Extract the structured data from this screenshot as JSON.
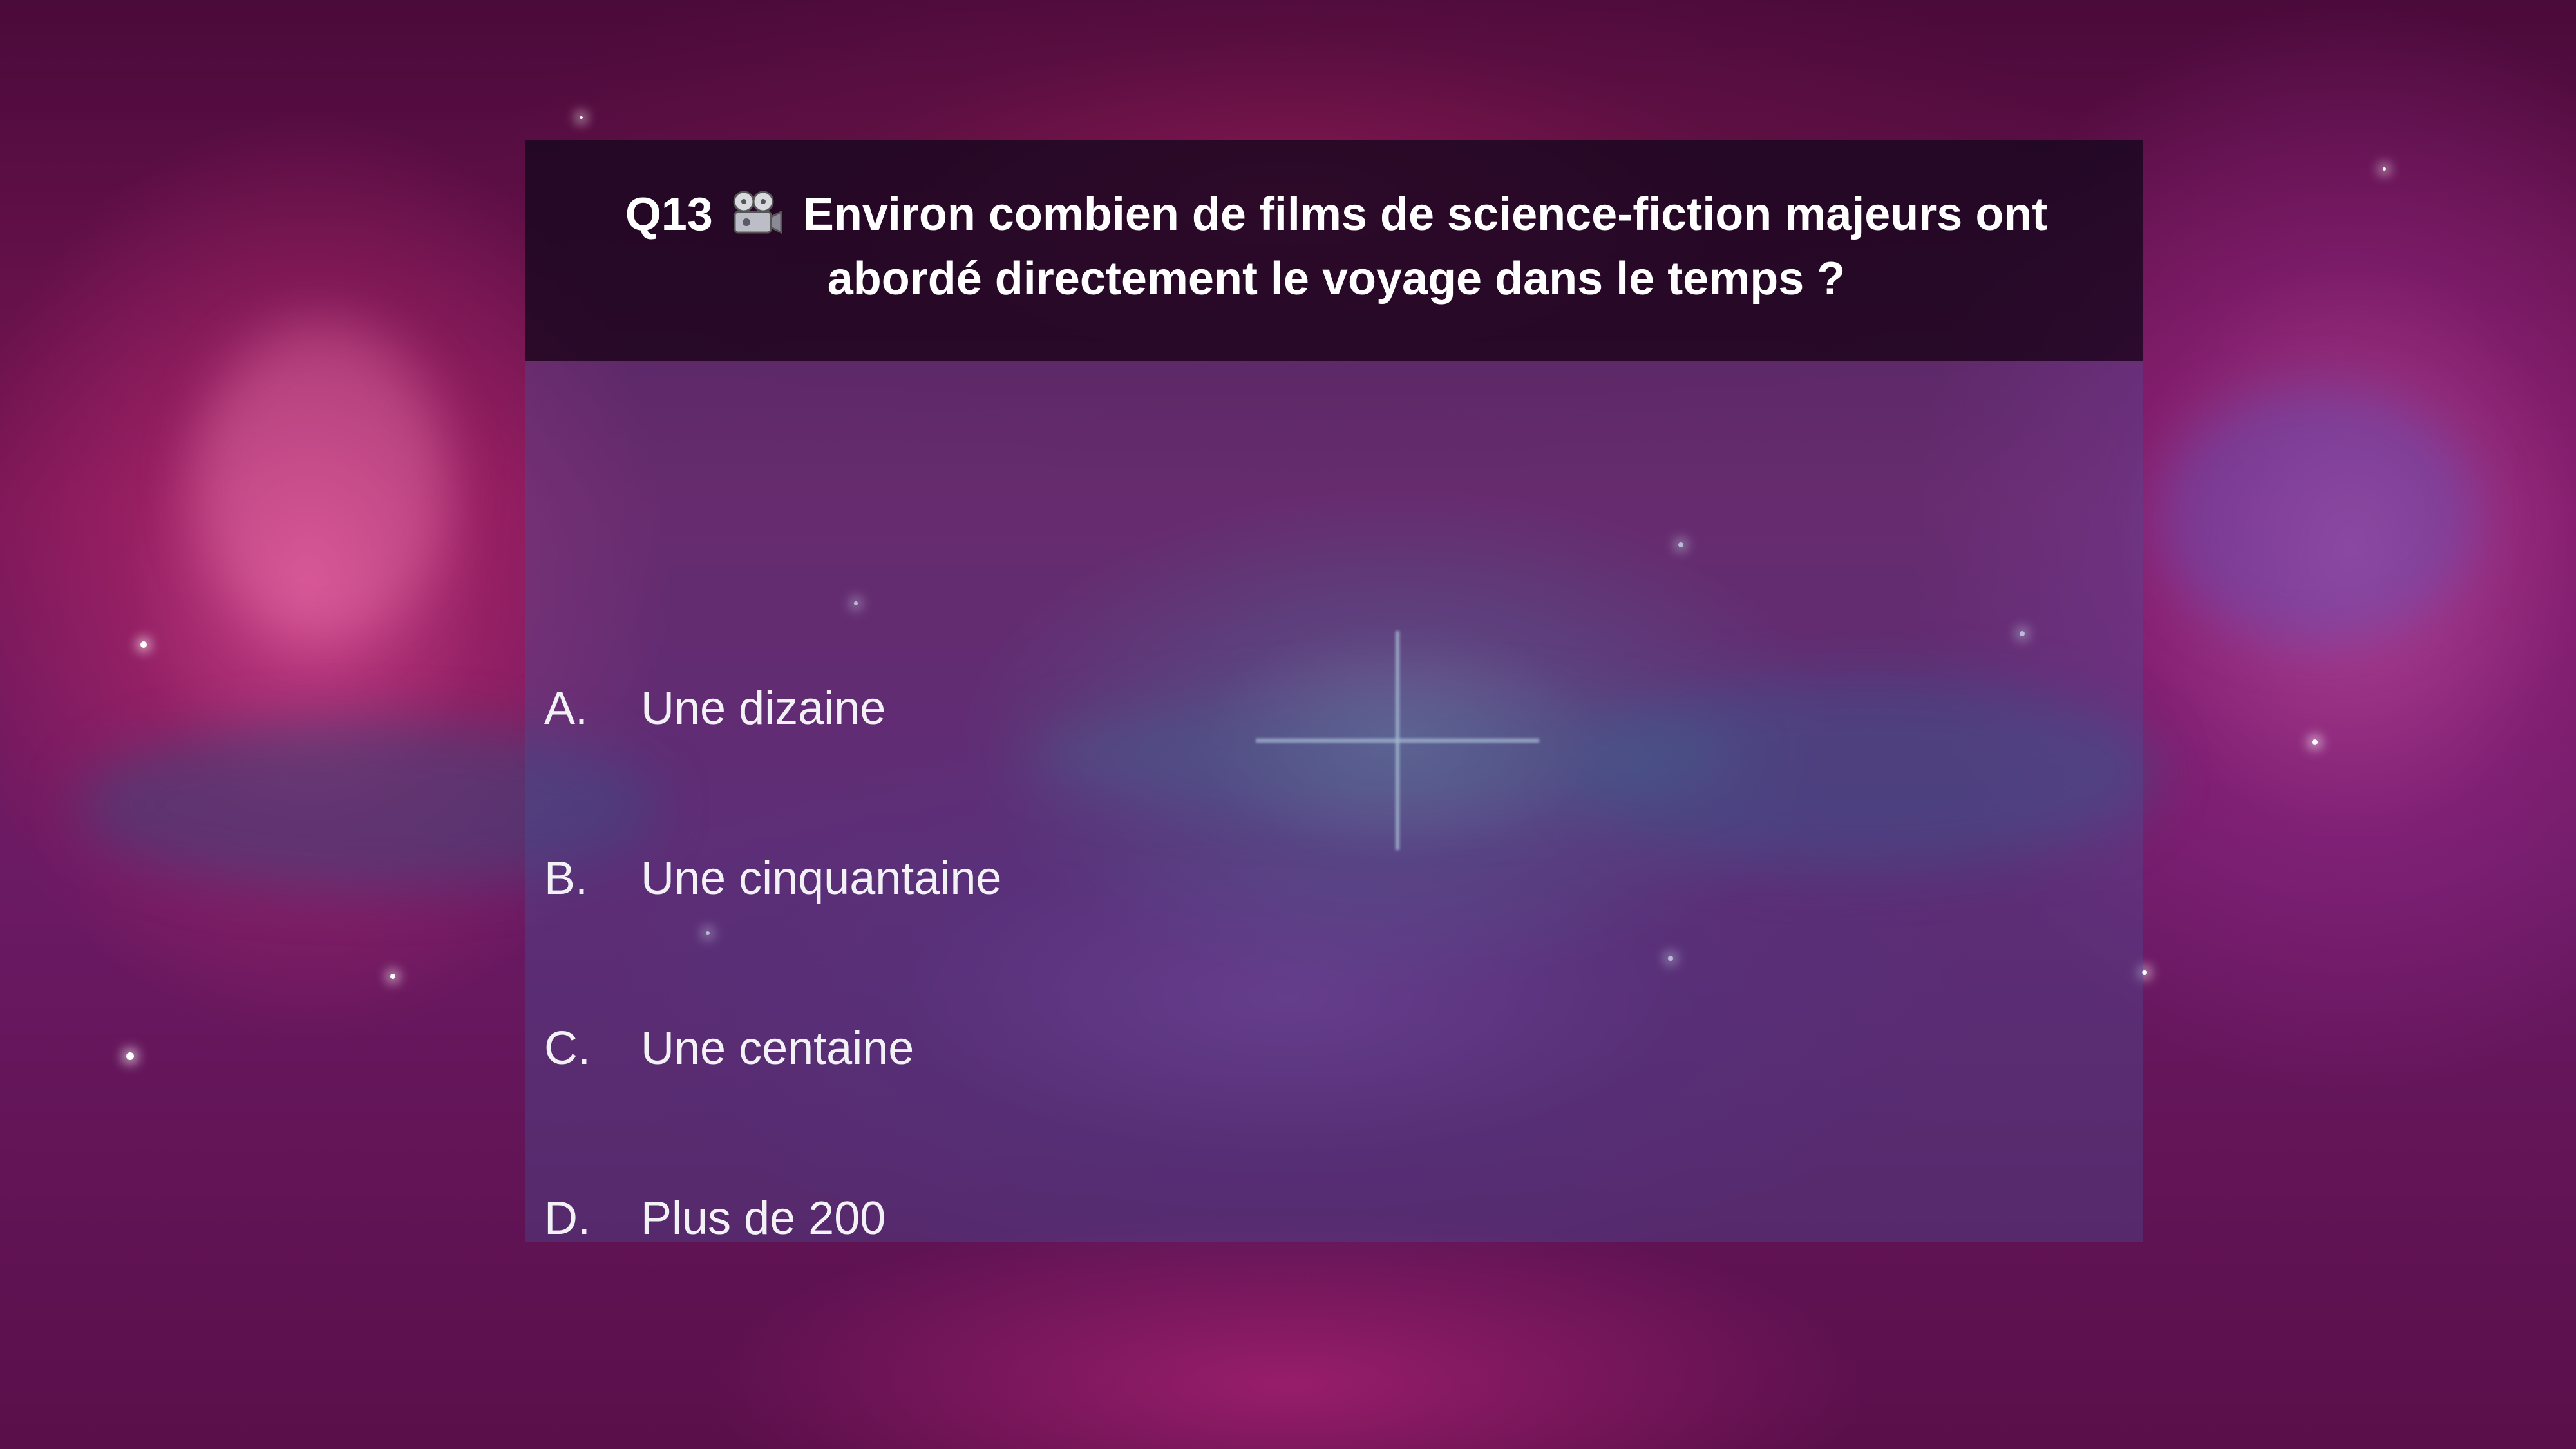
{
  "slide": {
    "question": {
      "number": "Q13",
      "icon": "film-projector-icon",
      "text": "Environ combien de films de science-fiction majeurs ont abordé directement le voyage dans le temps ?"
    },
    "answers": [
      {
        "letter": "A.",
        "text": "Une dizaine"
      },
      {
        "letter": "B.",
        "text": "Une cinquantaine"
      },
      {
        "letter": "C.",
        "text": "Une centaine"
      },
      {
        "letter": "D.",
        "text": "Plus de 200"
      }
    ]
  },
  "colors": {
    "header_background": "#14061e",
    "body_background": "#46509a",
    "text": "#ffffff"
  }
}
